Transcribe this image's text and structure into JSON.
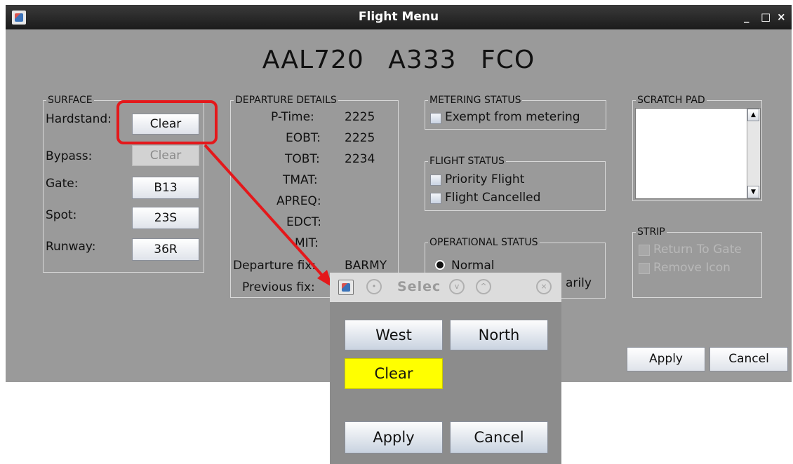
{
  "window": {
    "title": "Flight Menu",
    "controls": [
      "_",
      "□",
      "×"
    ]
  },
  "header": {
    "callsign": "AAL720",
    "aircraft": "A333",
    "destination": "FCO"
  },
  "surface": {
    "legend": "SURFACE",
    "rows": [
      {
        "label": "Hardstand:",
        "button": "Clear",
        "enabled": true
      },
      {
        "label": "Bypass:",
        "button": "Clear",
        "enabled": false
      },
      {
        "label": "Gate:",
        "button": "B13",
        "enabled": true
      },
      {
        "label": "Spot:",
        "button": "23S",
        "enabled": true
      },
      {
        "label": "Runway:",
        "button": "36R",
        "enabled": true
      }
    ]
  },
  "departure": {
    "legend": "DEPARTURE DETAILS",
    "rows": [
      {
        "label": "P-Time:",
        "value": "2225"
      },
      {
        "label": "EOBT:",
        "value": "2225"
      },
      {
        "label": "TOBT:",
        "value": "2234"
      },
      {
        "label": "TMAT:",
        "value": ""
      },
      {
        "label": "APREQ:",
        "value": ""
      },
      {
        "label": "EDCT:",
        "value": ""
      },
      {
        "label": "MIT:",
        "value": ""
      },
      {
        "label": "Departure fix:",
        "value": "BARMY"
      },
      {
        "label": "Previous fix:",
        "value": ""
      }
    ]
  },
  "metering": {
    "legend": "METERING STATUS",
    "exempt_label": "Exempt from metering"
  },
  "flight_status": {
    "legend": "FLIGHT STATUS",
    "priority_label": "Priority Flight",
    "cancelled_label": "Flight Cancelled"
  },
  "operational": {
    "legend": "OPERATIONAL STATUS",
    "normal_label": "Normal",
    "temp_label": "arily"
  },
  "scratch": {
    "legend": "SCRATCH PAD",
    "text": ""
  },
  "strip": {
    "legend": "STRIP",
    "return_label": "Return To Gate",
    "remove_label": "Remove Icon"
  },
  "footer": {
    "apply": "Apply",
    "cancel": "Cancel"
  },
  "popup": {
    "title": "Selec",
    "buttons": [
      "West",
      "North",
      "Clear"
    ],
    "apply": "Apply",
    "cancel": "Cancel"
  },
  "colors": {
    "highlight": "#e4181b",
    "selected_button": "#ffff00"
  }
}
